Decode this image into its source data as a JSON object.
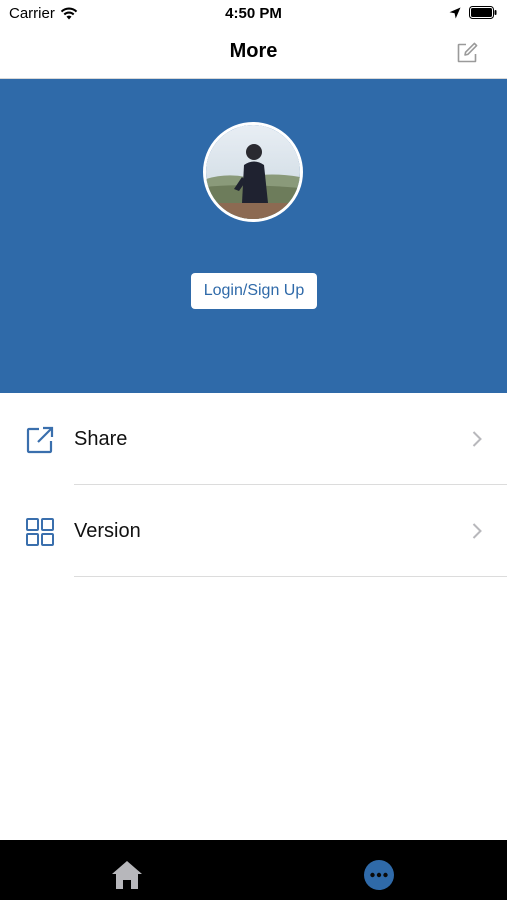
{
  "status_bar": {
    "carrier": "Carrier",
    "time": "4:50 PM",
    "icons": [
      "wifi-icon",
      "location-arrow-icon",
      "battery-icon"
    ]
  },
  "nav": {
    "title": "More",
    "right_icon": "edit-icon"
  },
  "hero": {
    "background_color": "#2f6aa9",
    "login_label": "Login/Sign Up"
  },
  "menu": {
    "items": [
      {
        "label": "Share",
        "icon": "share-external-icon"
      },
      {
        "label": "Version",
        "icon": "grid-icon"
      }
    ]
  },
  "tab_bar": {
    "tabs": [
      {
        "icon": "home-icon",
        "active": false
      },
      {
        "icon": "more-icon",
        "active": true
      }
    ],
    "active_color": "#2f6aa9",
    "inactive_color": "#b7b7bb"
  }
}
